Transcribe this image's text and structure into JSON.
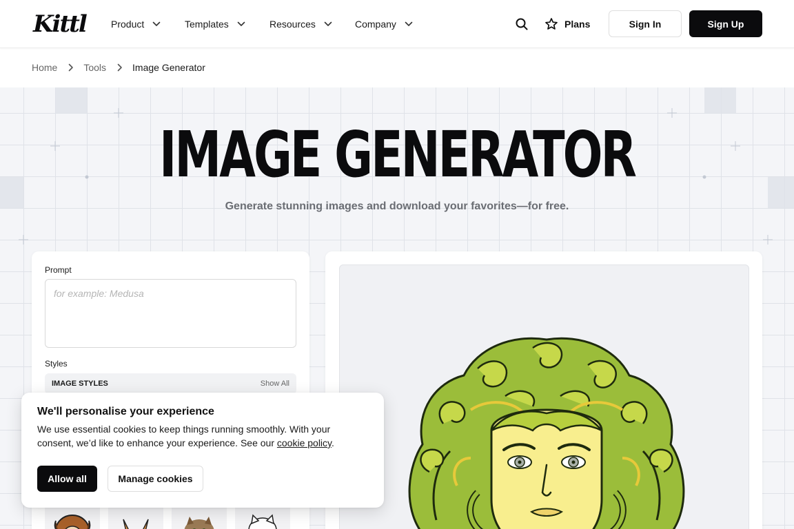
{
  "header": {
    "logo_text": "Kittl",
    "nav": [
      {
        "label": "Product"
      },
      {
        "label": "Templates"
      },
      {
        "label": "Resources"
      },
      {
        "label": "Company"
      }
    ],
    "plans_label": "Plans",
    "sign_in": "Sign In",
    "sign_up": "Sign Up"
  },
  "breadcrumb": [
    "Home",
    "Tools",
    "Image Generator"
  ],
  "hero": {
    "title": "IMAGE GENERATOR",
    "subtitle": "Generate stunning images and download your favorites—for free."
  },
  "generator": {
    "prompt_label": "Prompt",
    "prompt_placeholder": "for example: Medusa",
    "prompt_value": "",
    "styles_label": "Styles",
    "styles_heading": "IMAGE STYLES",
    "show_all": "Show All"
  },
  "cookie": {
    "title": "We'll personalise your experience",
    "body": "We use essential cookies to keep things running smoothly. With your consent, we’d like to enhance your experience. See our",
    "link": "cookie policy",
    "tail": ".",
    "allow_all": "Allow all",
    "manage": "Manage cookies"
  },
  "colors": {
    "primary_button": "#0b0b0d",
    "grid_background": "#f4f5f8",
    "grid_line": "#dfe2e8",
    "muted_text": "#6a6d73"
  }
}
